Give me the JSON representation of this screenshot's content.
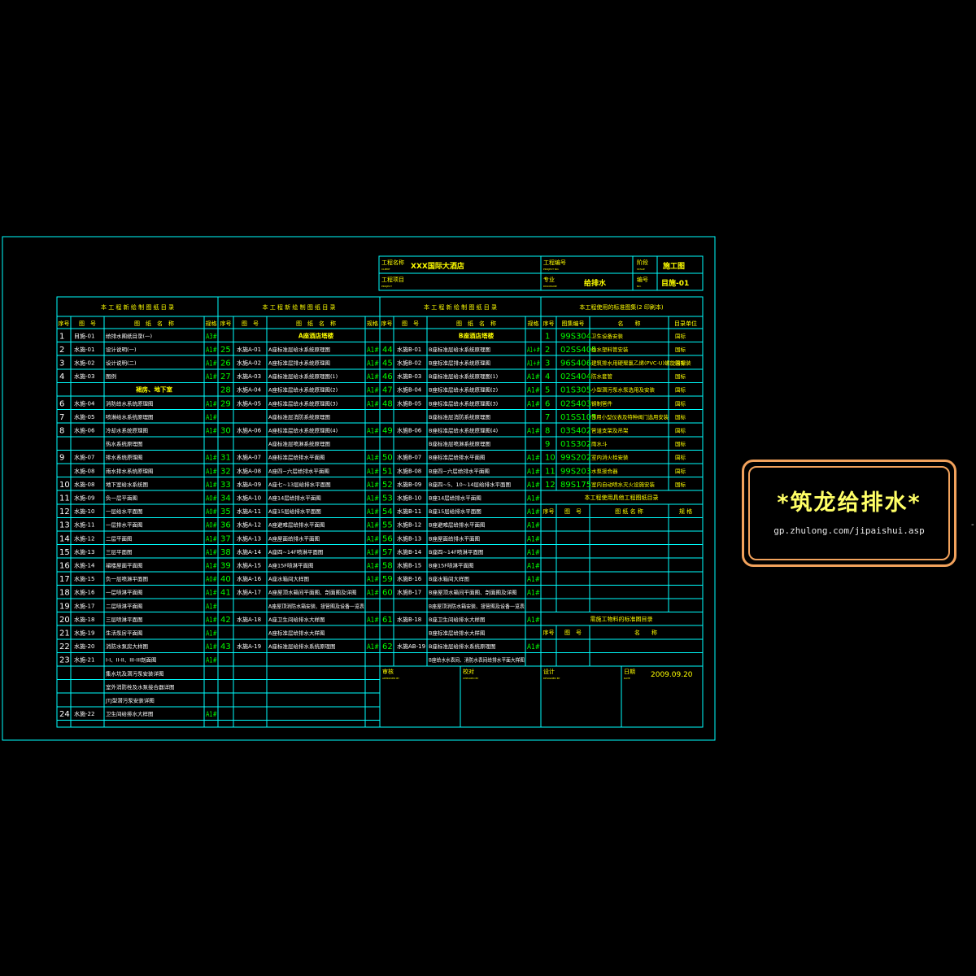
{
  "colors": {
    "line": "#00ffff",
    "text_white": "#ffffff",
    "text_green": "#00ff00",
    "text_yellow": "#ffff00",
    "logo_border": "#f2a25c",
    "logo_text": "#ffff66"
  },
  "title_block": {
    "client_label": "工程名称",
    "client_sub": "CLIENT",
    "client_value": "XXX国际大酒店",
    "project_label": "工程项目",
    "project_sub": "PROJECT",
    "project_value": "",
    "project_no_label": "工程编号",
    "project_no_sub": "PROJECT NO.",
    "project_no_value": "",
    "discipline_label": "专业",
    "discipline_sub": "DISCIPLINE",
    "discipline_value": "给排水",
    "stage_label": "阶段",
    "stage_sub": "STAGE",
    "stage_value": "施工图",
    "no_label": "编号",
    "no_sub": "NO.",
    "no_value": "目施-01"
  },
  "section_titles": {
    "s1": "本 工 程 新 绘 制 图 纸 目 录",
    "s2": "本 工 程 新 绘 制 图 纸 目 录",
    "s3": "本 工 程 新 绘 制 图 纸 目 录",
    "s4": "本工程使用的标准图集(2 印刷本)",
    "s5": "本工程使用具他工程图纸目录",
    "s6": "需施工物料的标准图目录"
  },
  "headers": {
    "drawing": [
      "序号",
      "图　号",
      "图　纸　名　称",
      "规格"
    ],
    "std": [
      "序号",
      "图集编号",
      "名　　称",
      "目录单位"
    ],
    "other": [
      "序号",
      "图　号",
      "图 纸 名 称",
      "规 格"
    ],
    "mat": [
      "序号",
      "图　号",
      "名　　称"
    ]
  },
  "col1": [
    {
      "n": "1",
      "code": "目施-01",
      "name": "给排水图纸目录(一)",
      "spec": "A3#"
    },
    {
      "n": "2",
      "code": "水施-01",
      "name": "设计说明(一)",
      "spec": "A1#"
    },
    {
      "n": "3",
      "code": "水施-02",
      "name": "设计说明(二)",
      "spec": "A1#"
    },
    {
      "n": "4",
      "code": "水施-03",
      "name": "图例",
      "spec": "A1#"
    },
    {
      "n": "",
      "code": "",
      "name": "裙房、地下室",
      "spec": "",
      "heading": true
    },
    {
      "n": "6",
      "code": "水施-04",
      "name": "消防给水系统原理图",
      "spec": "A1#"
    },
    {
      "n": "7",
      "code": "水施-05",
      "name": "喷淋给水系统原理图",
      "spec": "A1#"
    },
    {
      "n": "8",
      "code": "水施-06",
      "name": "冷却水系统原理图",
      "spec": "A1#"
    },
    {
      "n": "",
      "code": "",
      "name": "热水系统原理图",
      "spec": ""
    },
    {
      "n": "9",
      "code": "水施-07",
      "name": "排水系统原理图",
      "spec": "A1#"
    },
    {
      "n": "",
      "code": "水施-08",
      "name": "雨水排水系统原理图",
      "spec": "A1#"
    },
    {
      "n": "10",
      "code": "水施-08",
      "name": "地下室给水系统图",
      "spec": "A1#"
    },
    {
      "n": "11",
      "code": "水施-09",
      "name": "负一层平面图",
      "spec": "A0#"
    },
    {
      "n": "12",
      "code": "水施-10",
      "name": "一层给水平面图",
      "spec": "A0#"
    },
    {
      "n": "13",
      "code": "水施-11",
      "name": "一层排水平面图",
      "spec": "A0#"
    },
    {
      "n": "14",
      "code": "水施-12",
      "name": "二层平面图",
      "spec": "A1#"
    },
    {
      "n": "15",
      "code": "水施-13",
      "name": "三层平面图",
      "spec": "A1#"
    },
    {
      "n": "16",
      "code": "水施-14",
      "name": "裙楼屋面平面图",
      "spec": "A1#"
    },
    {
      "n": "17",
      "code": "水施-15",
      "name": "负一层喷淋平面图",
      "spec": "A0#"
    },
    {
      "n": "18",
      "code": "水施-16",
      "name": "一层喷淋平面图",
      "spec": "A1#"
    },
    {
      "n": "19",
      "code": "水施-17",
      "name": "二层喷淋平面图",
      "spec": "A1#"
    },
    {
      "n": "20",
      "code": "水施-18",
      "name": "三层喷淋平面图",
      "spec": "A1#"
    },
    {
      "n": "21",
      "code": "水施-19",
      "name": "生活泵房平面图",
      "spec": "A1#"
    },
    {
      "n": "22",
      "code": "水施-20",
      "name": "消防水泵房大样图",
      "spec": "A1#"
    },
    {
      "n": "23",
      "code": "水施-21",
      "name": "I-I、II-II、III-III剖面图",
      "spec": "A1#"
    },
    {
      "n": "",
      "code": "",
      "name": "集水坑及潜污泵安装详图",
      "spec": ""
    },
    {
      "n": "",
      "code": "",
      "name": "室外消防栓及水泵接合器详图",
      "spec": ""
    },
    {
      "n": "",
      "code": "",
      "name": "JTJ型潜污泵安装详图",
      "spec": ""
    },
    {
      "n": "24",
      "code": "水施-22",
      "name": "卫生间给排水大样图",
      "spec": "A1#"
    }
  ],
  "col2": [
    {
      "n": "",
      "code": "",
      "name": "A座酒店塔楼",
      "spec": "",
      "heading": true
    },
    {
      "n": "25",
      "code": "水施A-01",
      "name": "A座标准层给水系统原理图",
      "spec": "A1#"
    },
    {
      "n": "26",
      "code": "水施A-02",
      "name": "A座标准层排水系统原理图",
      "spec": "A1#"
    },
    {
      "n": "27",
      "code": "水施A-03",
      "name": "A座标准层给水系统原理图(1)",
      "spec": "A1#"
    },
    {
      "n": "28",
      "code": "水施A-04",
      "name": "A座标准层给水系统原理图(2)",
      "spec": "A1#"
    },
    {
      "n": "29",
      "code": "水施A-05",
      "name": "A座标准层给水系统原理图(3)",
      "spec": "A1#"
    },
    {
      "n": "",
      "code": "",
      "name": "A座标准层消防系统原理图",
      "spec": ""
    },
    {
      "n": "30",
      "code": "水施A-06",
      "name": "A座标准层给水系统原理图(4)",
      "spec": "A1#"
    },
    {
      "n": "",
      "code": "",
      "name": "A座标准层喷淋系统原理图",
      "spec": ""
    },
    {
      "n": "31",
      "code": "水施A-07",
      "name": "A座标准层给排水平面图",
      "spec": "A1#"
    },
    {
      "n": "32",
      "code": "水施A-08",
      "name": "A座四~六层给排水平面图",
      "spec": "A1#"
    },
    {
      "n": "33",
      "code": "水施A-09",
      "name": "A座七~13层给排水平面图",
      "spec": "A1#"
    },
    {
      "n": "34",
      "code": "水施A-10",
      "name": "A座14层给排水平面图",
      "spec": "A1#"
    },
    {
      "n": "35",
      "code": "水施A-11",
      "name": "A座15层给排水平面图",
      "spec": "A1#"
    },
    {
      "n": "36",
      "code": "水施A-12",
      "name": "A座避难层给排水平面图",
      "spec": "A1#"
    },
    {
      "n": "37",
      "code": "水施A-13",
      "name": "A座屋面给排水平面图",
      "spec": "A1#"
    },
    {
      "n": "38",
      "code": "水施A-14",
      "name": "A座四~14F喷淋平面图",
      "spec": "A1#"
    },
    {
      "n": "39",
      "code": "水施A-15",
      "name": "A座15F喷淋平面图",
      "spec": "A1#"
    },
    {
      "n": "40",
      "code": "水施A-16",
      "name": "A座水箱间大样图",
      "spec": "A1#"
    },
    {
      "n": "41",
      "code": "水施A-17",
      "name": "A座屋顶水箱间平面图、剖面图及详图",
      "spec": "A1#"
    },
    {
      "n": "",
      "code": "",
      "name": "A座屋顶消防水箱安装、接管图及设备一览表",
      "spec": ""
    },
    {
      "n": "42",
      "code": "水施A-18",
      "name": "A座卫生间给排水大样图",
      "spec": "A1#"
    },
    {
      "n": "",
      "code": "",
      "name": "A座标准层给排水大样图",
      "spec": ""
    },
    {
      "n": "43",
      "code": "水施A-19",
      "name": "A座标准层给排水系统原理图",
      "spec": "A1#"
    },
    {
      "n": "",
      "code": "",
      "name": "",
      "spec": ""
    },
    {
      "n": "",
      "code": "",
      "name": "",
      "spec": ""
    },
    {
      "n": "",
      "code": "",
      "name": "",
      "spec": ""
    },
    {
      "n": "",
      "code": "",
      "name": "",
      "spec": ""
    },
    {
      "n": "",
      "code": "",
      "name": "",
      "spec": ""
    }
  ],
  "col3": [
    {
      "n": "",
      "code": "",
      "name": "B座酒店塔楼",
      "spec": "",
      "heading": true
    },
    {
      "n": "44",
      "code": "水施B-01",
      "name": "B座标准层给水系统原理图",
      "spec": "A1+#"
    },
    {
      "n": "45",
      "code": "水施B-02",
      "name": "B座标准层排水系统原理图",
      "spec": "A1+#"
    },
    {
      "n": "46",
      "code": "水施B-03",
      "name": "B座标准层给水系统原理图(1)",
      "spec": "A1#"
    },
    {
      "n": "47",
      "code": "水施B-04",
      "name": "B座标准层给水系统原理图(2)",
      "spec": "A1#"
    },
    {
      "n": "48",
      "code": "水施B-05",
      "name": "B座标准层给水系统原理图(3)",
      "spec": "A1#"
    },
    {
      "n": "",
      "code": "",
      "name": "B座标准层消防系统原理图",
      "spec": ""
    },
    {
      "n": "49",
      "code": "水施B-06",
      "name": "B座标准层给水系统原理图(4)",
      "spec": "A1#"
    },
    {
      "n": "",
      "code": "",
      "name": "B座标准层喷淋系统原理图",
      "spec": ""
    },
    {
      "n": "50",
      "code": "水施B-07",
      "name": "B座标准层给排水平面图",
      "spec": "A1#"
    },
    {
      "n": "51",
      "code": "水施B-08",
      "name": "B座四~六层给排水平面图",
      "spec": "A1#"
    },
    {
      "n": "52",
      "code": "水施B-09",
      "name": "B座四~5、10~14层给排水平面图",
      "spec": "A1#"
    },
    {
      "n": "53",
      "code": "水施B-10",
      "name": "B座14层给排水平面图",
      "spec": "A1#"
    },
    {
      "n": "54",
      "code": "水施B-11",
      "name": "B座15层给排水平面图",
      "spec": "A1#"
    },
    {
      "n": "55",
      "code": "水施B-12",
      "name": "B座避难层给排水平面图",
      "spec": "A1#"
    },
    {
      "n": "56",
      "code": "水施B-13",
      "name": "B座屋面给排水平面图",
      "spec": "A1#"
    },
    {
      "n": "57",
      "code": "水施B-14",
      "name": "B座四~14F喷淋平面图",
      "spec": "A1#"
    },
    {
      "n": "58",
      "code": "水施B-15",
      "name": "B座15F喷淋平面图",
      "spec": "A1#"
    },
    {
      "n": "59",
      "code": "水施B-16",
      "name": "B座水箱间大样图",
      "spec": "A1#"
    },
    {
      "n": "60",
      "code": "水施B-17",
      "name": "B座屋顶水箱间平面图、剖面图及详图",
      "spec": "A1#"
    },
    {
      "n": "",
      "code": "",
      "name": "B座屋顶消防水箱安装、接管图及设备一览表",
      "spec": ""
    },
    {
      "n": "61",
      "code": "水施B-18",
      "name": "B座卫生间给排水大样图",
      "spec": "A1#"
    },
    {
      "n": "",
      "code": "",
      "name": "B座标准层给排水大样图",
      "spec": ""
    },
    {
      "n": "62",
      "code": "水施AB-19",
      "name": "B座标准层给排水系统原理图",
      "spec": "A1#"
    },
    {
      "n": "",
      "code": "",
      "name": "B座给水水表间、消防水表间给排水平面大样图",
      "spec": ""
    }
  ],
  "std_rows": [
    {
      "n": "1",
      "code": "99S304",
      "name": "卫生设备安装",
      "unit": "国标"
    },
    {
      "n": "2",
      "code": "02SS405",
      "name": "给水塑料管安装",
      "unit": "国标"
    },
    {
      "n": "3",
      "code": "96S406",
      "name": "建筑排水用硬聚氯乙烯(PVC-U)螺旋管安装",
      "unit": "国标"
    },
    {
      "n": "4",
      "code": "02S404",
      "name": "防水套管",
      "unit": "国标"
    },
    {
      "n": "5",
      "code": "01S305",
      "name": "小型潜污泵水泵选用及安装",
      "unit": "国标"
    },
    {
      "n": "6",
      "code": "02S403",
      "name": "钢制管件",
      "unit": "国标"
    },
    {
      "n": "7",
      "code": "01SS105",
      "name": "常用小型仪表及特种阀门选用安装",
      "unit": "国标"
    },
    {
      "n": "8",
      "code": "03S402",
      "name": "管道支架及吊架",
      "unit": "国标"
    },
    {
      "n": "9",
      "code": "01S302",
      "name": "雨水斗",
      "unit": "国标"
    },
    {
      "n": "10",
      "code": "99S202",
      "name": "室内消火栓安装",
      "unit": "国标"
    },
    {
      "n": "11",
      "code": "99S203",
      "name": "水泵接合器",
      "unit": "国标"
    },
    {
      "n": "12",
      "code": "89S175",
      "name": "室内自动喷水灭火设施安装",
      "unit": "国标"
    }
  ],
  "sign": {
    "approved_label": "审核",
    "approved_sub": "APPROVED BY",
    "checked_label": "校对",
    "checked_sub": "CHECKED BY",
    "designed_label": "设计",
    "designed_sub": "DESIGNED BY",
    "date_label": "日期",
    "date_sub": "DATE",
    "date_value": "2009.09.20"
  },
  "logo": {
    "title": "*筑龙给排水*",
    "url": "gp.zhulong.com/jipaishui.asp",
    "dash": "-"
  }
}
